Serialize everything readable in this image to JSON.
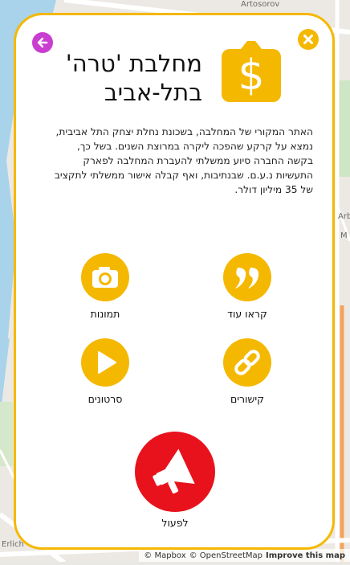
{
  "map": {
    "street_labels": [
      "Artosorov",
      "Erlich",
      "Arba",
      "M"
    ],
    "attribution": {
      "mapbox": "© Mapbox",
      "osm": "© OpenStreetMap",
      "improve": "Improve this map"
    }
  },
  "card": {
    "title_line1": "מחלבת 'טרה'",
    "title_line2": "בתל-אביב",
    "description": "האתר המקורי של המחלבה, בשכונת נחלת יצחק התל אביבית, נמצא על קרקע שהפכה ליקרה במרוצת השנים. בשל כך, בקשה החברה סיוע ממשלתי להעברת המחלבה לפארק התעשיות נ.ע.ם. שבנתיבות, ואף קבלה אישור ממשלתי לתקציב של 35 מיליון דולר.",
    "actions": {
      "read_more": "קראו עוד",
      "photos": "תמונות",
      "links": "קישורים",
      "videos": "סרטונים",
      "act": "לפעול"
    },
    "icons": {
      "back": "arrow-left-icon",
      "close": "close-icon",
      "money": "money-bag-icon",
      "quote": "quote-icon",
      "camera": "camera-icon",
      "link": "link-icon",
      "play": "play-icon",
      "megaphone": "megaphone-icon"
    },
    "colors": {
      "accent": "#f5b800",
      "back": "#c93ed0",
      "action_red": "#e8121c"
    }
  }
}
